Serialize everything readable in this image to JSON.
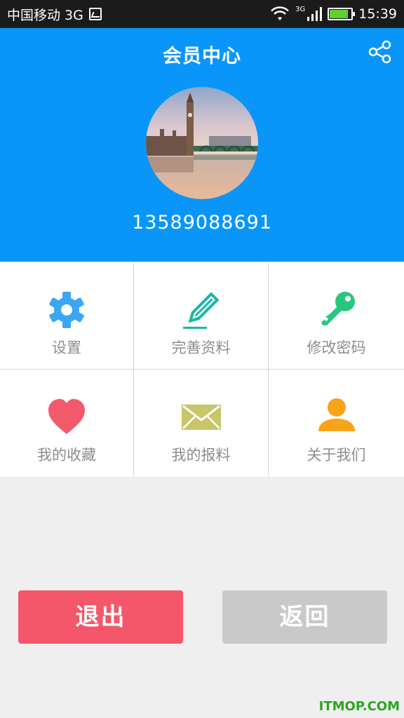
{
  "status_bar": {
    "carrier": "中国移动 3G",
    "network": "3G",
    "time": "15:39"
  },
  "header": {
    "title": "会员中心",
    "share_icon": "share-icon",
    "phone": "13589088691",
    "background_color": "#0a96f8"
  },
  "menu": {
    "items": [
      {
        "label": "设置",
        "icon": "gear-icon",
        "color": "#3ba7f2"
      },
      {
        "label": "完善资料",
        "icon": "pencil-icon",
        "color": "#1ab8a6"
      },
      {
        "label": "修改密码",
        "icon": "key-icon",
        "color": "#26c97c"
      },
      {
        "label": "我的收藏",
        "icon": "heart-icon",
        "color": "#f25a6c"
      },
      {
        "label": "我的报料",
        "icon": "envelope-icon",
        "color": "#c9c56a"
      },
      {
        "label": "关于我们",
        "icon": "user-icon",
        "color": "#f7a41a"
      }
    ]
  },
  "buttons": {
    "logout_label": "退出",
    "back_label": "返回",
    "logout_color": "#f5576a",
    "back_color": "#c9c9c9"
  },
  "watermark": "ITMOP.COM"
}
